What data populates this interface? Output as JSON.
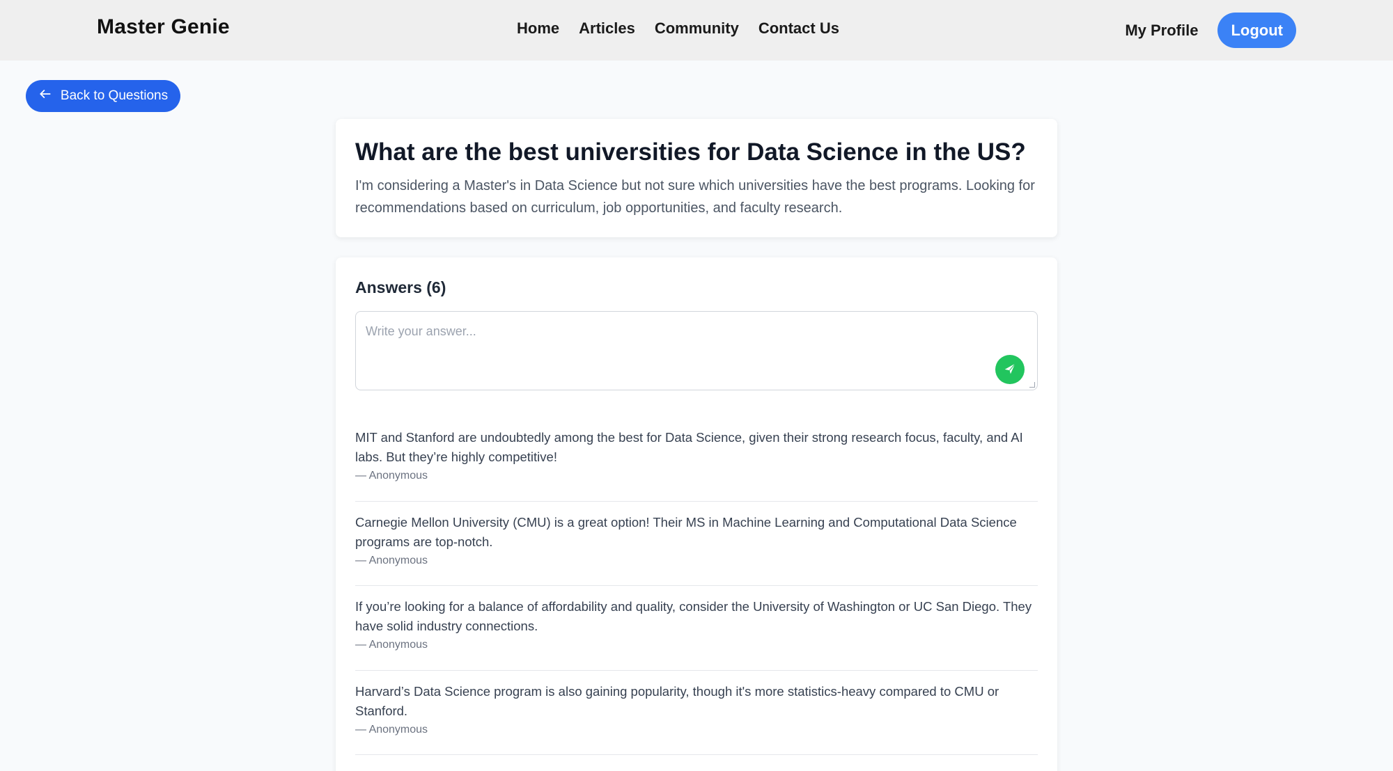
{
  "header": {
    "brand": "Master Genie",
    "nav": [
      "Home",
      "Articles",
      "Community",
      "Contact Us"
    ],
    "profile_label": "My Profile",
    "logout_label": "Logout"
  },
  "back_button": {
    "label": "Back to Questions",
    "icon": "arrow-left-icon"
  },
  "question": {
    "title": "What are the best universities for Data Science in the US?",
    "body": "I'm considering a Master's in Data Science but not sure which universities have the best programs. Looking for recommendations based on curriculum, job opportunities, and faculty research."
  },
  "answers": {
    "heading": "Answers (6)",
    "input_placeholder": "Write your answer...",
    "send_icon": "send-icon",
    "items": [
      {
        "text": "MIT and Stanford are undoubtedly among the best for Data Science, given their strong research focus, faculty, and AI labs. But they’re highly competitive!",
        "author": "— Anonymous"
      },
      {
        "text": "Carnegie Mellon University (CMU) is a great option! Their MS in Machine Learning and Computational Data Science programs are top-notch.",
        "author": "— Anonymous"
      },
      {
        "text": "If you’re looking for a balance of affordability and quality, consider the University of Washington or UC San Diego. They have solid industry connections.",
        "author": "— Anonymous"
      },
      {
        "text": "Harvard’s Data Science program is also gaining popularity, though it's more statistics-heavy compared to CMU or Stanford.",
        "author": "— Anonymous"
      }
    ]
  },
  "colors": {
    "primary": "#2563eb",
    "logout": "#3b82f6",
    "send": "#22c55e",
    "navbar_bg": "#efefef",
    "page_bg": "#f8fafc"
  }
}
